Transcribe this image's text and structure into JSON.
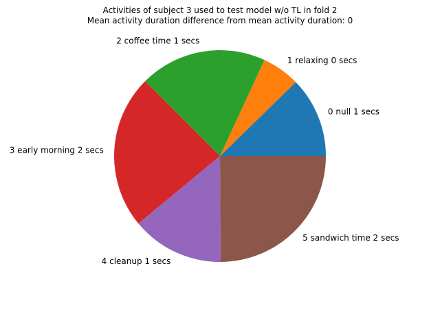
{
  "chart_data": {
    "type": "pie",
    "title_lines": [
      "Activities of subject 3 used to test model w/o TL in fold 2",
      "Mean activity duration difference from mean activity duration: 0"
    ],
    "start_angle_deg": 0,
    "direction": "counterclockwise",
    "slices": [
      {
        "label": "0 null 1 secs",
        "value": 12.3,
        "color": "#1f77b4"
      },
      {
        "label": "1 relaxing 0 secs",
        "value": 5.8,
        "color": "#ff7f0e"
      },
      {
        "label": "2 coffee time 1 secs",
        "value": 19.4,
        "color": "#2ca02c"
      },
      {
        "label": "3 early morning 2 secs",
        "value": 23.5,
        "color": "#d62728"
      },
      {
        "label": "4 cleanup 1 secs",
        "value": 14.1,
        "color": "#9467bd"
      },
      {
        "label": "5 sandwich time 2 secs",
        "value": 24.9,
        "color": "#8c564b"
      }
    ]
  }
}
